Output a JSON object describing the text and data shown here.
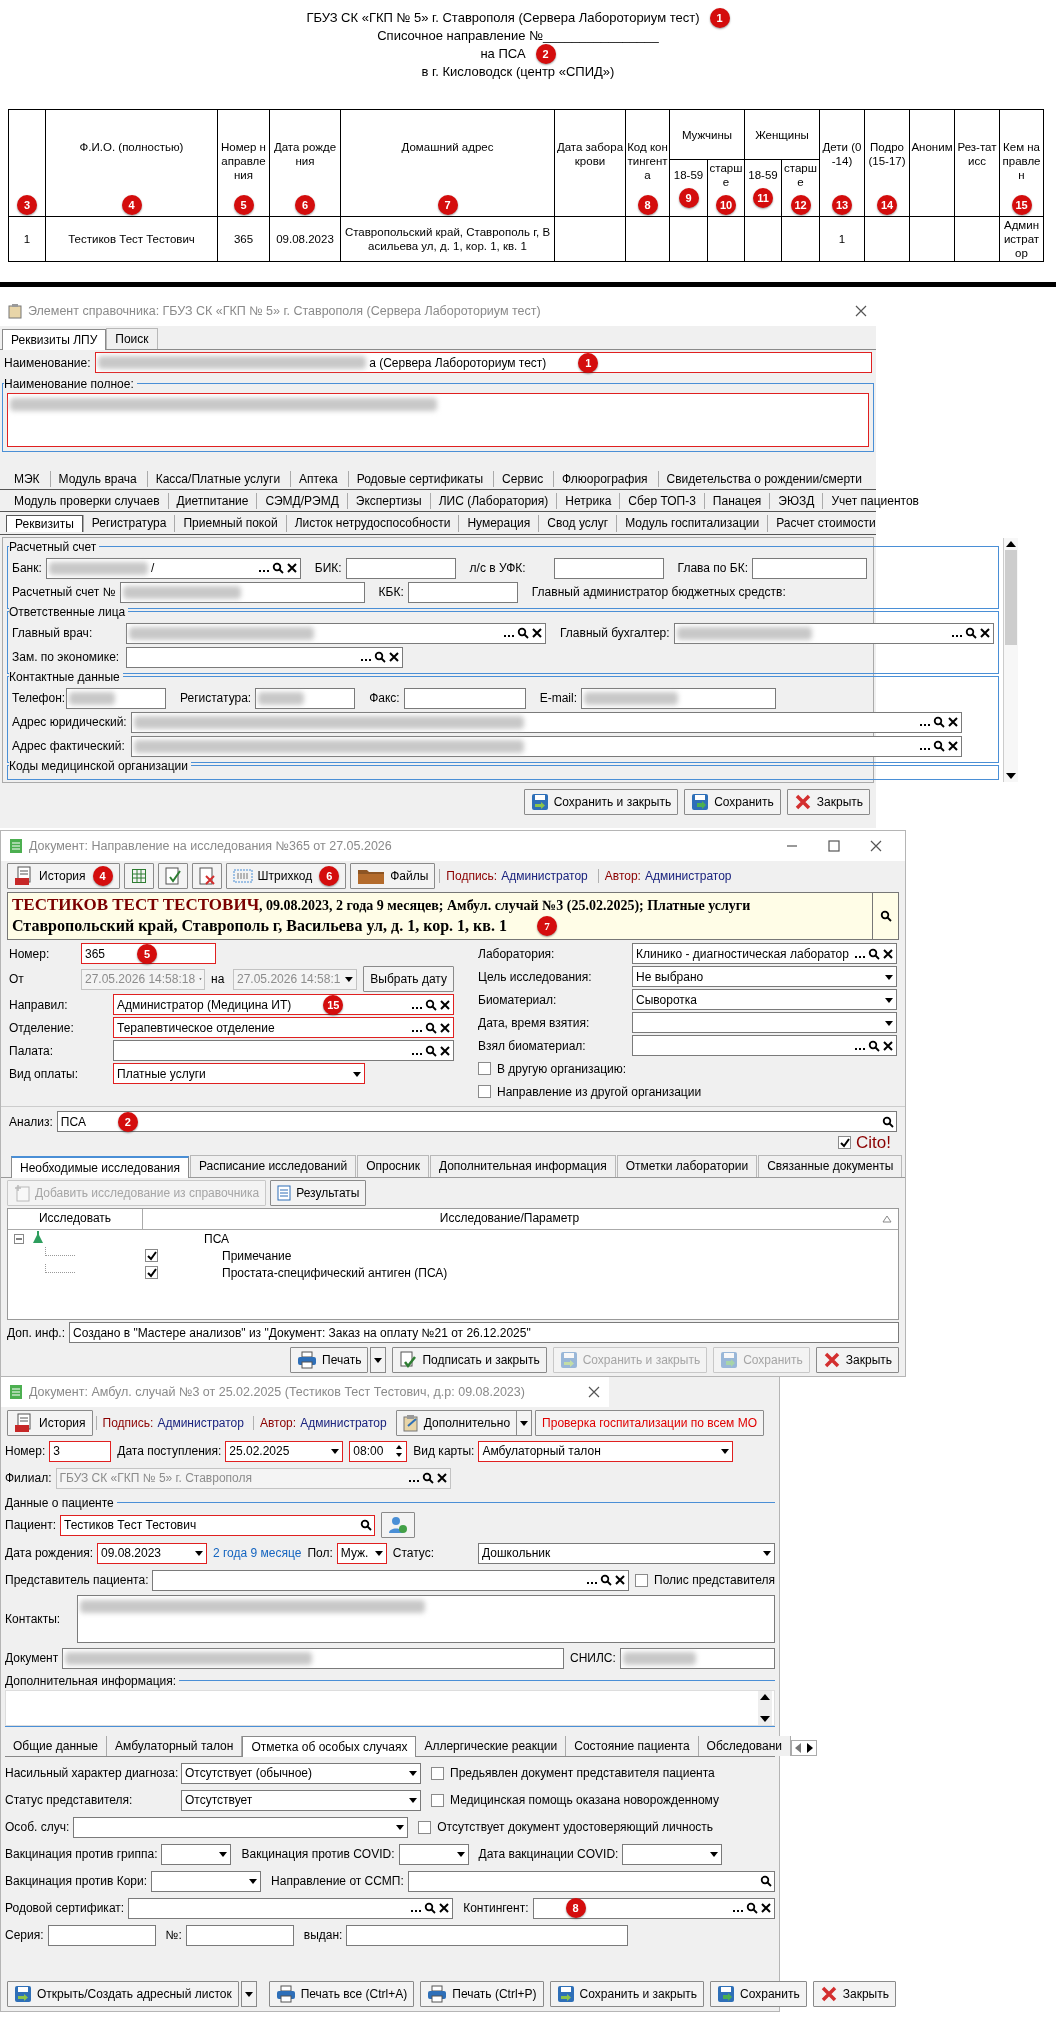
{
  "report": {
    "lines": [
      {
        "text": "ГБУЗ СК «ГКП № 5» г. Ставрополя (Сервера Лабороториум тест)",
        "callout": "1"
      },
      {
        "text": "Списочное направление №________________"
      },
      {
        "text": "на ПСА",
        "callout": "2"
      },
      {
        "text": "в г. Кисловодск (центр «СПИД»)"
      }
    ],
    "columns": [
      {
        "in_group": false,
        "callout": "3"
      },
      {
        "label": "Ф.И.О. (полностью)",
        "in_group": false,
        "callout": "4"
      },
      {
        "label": "Номер направления",
        "in_group": false,
        "callout": "5"
      },
      {
        "label": "Дата рождения",
        "in_group": false,
        "callout": "6"
      },
      {
        "label": "Домашний адрес",
        "in_group": false,
        "callout": "7"
      },
      {
        "label": "Дата забора крови",
        "in_group": false
      },
      {
        "label": "Код контингента",
        "in_group": false,
        "callout": "8"
      },
      {
        "group": "Мужчины",
        "label": "18-59",
        "in_group": true,
        "callout": "9"
      },
      {
        "label": "старше",
        "in_group": true,
        "callout": "10"
      },
      {
        "group": "Женщины",
        "label": "18-59",
        "in_group": true,
        "callout": "11"
      },
      {
        "label": "старше",
        "in_group": true,
        "callout": "12"
      },
      {
        "label": "Дети (0-14)",
        "in_group": false,
        "callout": "13"
      },
      {
        "label": "Подро (15-17)",
        "in_group": false,
        "callout": "14"
      },
      {
        "label": "Аноним",
        "in_group": false
      },
      {
        "label": "Рез-тат исс",
        "in_group": false
      },
      {
        "label": "Кем направлен",
        "in_group": false,
        "callout": "15"
      }
    ],
    "rows": [
      {
        "cells": [
          "1",
          "Тестиков Тест Тестович",
          "365",
          "09.08.2023",
          "Ставропольский край, Ставрополь г, Васильева ул, д. 1, кор. 1, кв. 1",
          null,
          null,
          null,
          null,
          null,
          null,
          "1",
          null,
          null,
          null,
          "Администратор"
        ]
      }
    ]
  },
  "reference_window": {
    "title": "Элемент справочника: ГБУЗ СК «ГКП № 5» г. Ставрополя (Сервера Лабороториум тест)",
    "tabs": [
      {
        "label": "Реквизиты ЛПУ",
        "selected": true
      },
      {
        "label": "Поиск",
        "selected": false
      }
    ],
    "name_field": {
      "label": "Наименование:",
      "value": "а (Сервера Лабороториум тест)",
      "kind": "text",
      "required": true,
      "disabled": false,
      "masked": true,
      "callout": "1"
    },
    "full_name": {
      "label": "Наименование полное:",
      "kind": "textarea",
      "required": true,
      "disabled": false,
      "masked": true
    },
    "module_tabs": [
      [
        {
          "label": "МЭК",
          "selected": false
        },
        {
          "label": "Модуль врача",
          "selected": false
        },
        {
          "label": "Касса/Платные услуги",
          "selected": false
        },
        {
          "label": "Аптека",
          "selected": false
        },
        {
          "label": "Родовые сертификаты",
          "selected": false
        },
        {
          "label": "Сервис",
          "selected": false
        },
        {
          "label": "Флюорография",
          "selected": false
        },
        {
          "label": "Свидетельства о рождении/смерти",
          "selected": false
        }
      ],
      [
        {
          "label": "Модуль проверки случаев",
          "selected": false
        },
        {
          "label": "Диетпитание",
          "selected": false
        },
        {
          "label": "СЭМД/РЭМД",
          "selected": false
        },
        {
          "label": "Экспертизы",
          "selected": false
        },
        {
          "label": "ЛИС (Лаборатория)",
          "selected": false
        },
        {
          "label": "Нетрика",
          "selected": false
        },
        {
          "label": "Сбер ТОП-3",
          "selected": false
        },
        {
          "label": "Панацея",
          "selected": false
        },
        {
          "label": "ЭЮЗД",
          "selected": false
        },
        {
          "label": "Учет пациентов",
          "selected": false
        }
      ],
      [
        {
          "label": "Реквизиты",
          "selected": true
        },
        {
          "label": "Регистратура",
          "selected": false
        },
        {
          "label": "Приемный покой",
          "selected": false
        },
        {
          "label": "Листок нетрудоспособности",
          "selected": false
        },
        {
          "label": "Нумерация",
          "selected": false
        },
        {
          "label": "Свод услуг",
          "selected": false
        },
        {
          "label": "Модуль госпитализации",
          "selected": false
        },
        {
          "label": "Расчет стоимости",
          "selected": false
        }
      ]
    ],
    "groups": [
      {
        "title": "Расчетный счет",
        "fields": [
          {
            "label": "Банк:",
            "value": "/",
            "kind": "lookup",
            "required": false,
            "disabled": false,
            "masked": true
          },
          {
            "label": "БИК:",
            "kind": "text",
            "required": false,
            "disabled": false,
            "masked": false
          },
          {
            "label": "л/с в УФК:",
            "kind": "text",
            "required": false,
            "disabled": false,
            "masked": false
          },
          {
            "label": "Глава по БК:",
            "kind": "text",
            "required": false,
            "disabled": false,
            "masked": false
          },
          {
            "label": "Расчетный счет №",
            "kind": "text",
            "required": false,
            "disabled": false,
            "masked": true
          },
          {
            "label": "КБК:",
            "kind": "text",
            "required": false,
            "disabled": false,
            "masked": false
          },
          {
            "label": "Главный администратор бюджетных средств:",
            "kind": "label"
          }
        ]
      },
      {
        "title": "Ответственные лица",
        "fields": [
          {
            "label": "Главный врач:",
            "kind": "lookup",
            "required": false,
            "disabled": false,
            "masked": true
          },
          {
            "label": "Главный бухгалтер:",
            "kind": "lookup",
            "required": false,
            "disabled": false,
            "masked": true
          },
          {
            "label": "Зам. по экономике:",
            "kind": "lookup",
            "required": false,
            "disabled": false,
            "masked": false
          }
        ]
      },
      {
        "title": "Контактные данные",
        "fields": [
          {
            "label": "Телефон:",
            "kind": "text",
            "required": false,
            "disabled": false,
            "masked": true
          },
          {
            "label": "Регистатура:",
            "kind": "text",
            "required": false,
            "disabled": false,
            "masked": true
          },
          {
            "label": "Факс:",
            "kind": "text",
            "required": false,
            "disabled": false,
            "masked": false
          },
          {
            "label": "E-mail:",
            "kind": "text",
            "required": false,
            "disabled": false,
            "masked": true
          },
          {
            "label": "Адрес юридический:",
            "kind": "lookup",
            "required": false,
            "disabled": false,
            "masked": true
          },
          {
            "label": "Адрес фактический:",
            "kind": "lookup",
            "required": false,
            "disabled": false,
            "masked": true
          }
        ]
      },
      {
        "title": "Коды медицинской организации"
      }
    ],
    "buttons": [
      {
        "kind": "save_close",
        "label": "Сохранить и закрыть",
        "disabled": false
      },
      {
        "kind": "save",
        "label": "Сохранить",
        "disabled": false
      },
      {
        "kind": "close",
        "label": "Закрыть",
        "disabled": false
      }
    ]
  },
  "referral_window": {
    "title": "Документ: Направление на исследования №365 от 27.05.2026",
    "toolbar": [
      {
        "kind": "history",
        "label": "История",
        "disabled": false,
        "callout": "4"
      },
      {
        "kind": "grid",
        "disabled": false
      },
      {
        "kind": "check_doc",
        "disabled": false
      },
      {
        "kind": "delete_doc",
        "disabled": false
      },
      {
        "kind": "barcode",
        "label": "Штрихкод",
        "disabled": false,
        "callout": "6"
      },
      {
        "kind": "files",
        "label": "Файлы",
        "disabled": false
      }
    ],
    "signature": {
      "label": "Подпись:",
      "value": "Администратор"
    },
    "author": {
      "label": "Автор:",
      "value": "Администратор"
    },
    "summary": {
      "name": "ТЕСТИКОВ ТЕСТ ТЕСТОВИЧ",
      "details": ", 09.08.2023, 2 года 9 месяцев; Амбул. случай №3 (25.02.2025); Платные услуги",
      "address": "Ставропольский край, Ставрополь г, Васильева ул, д. 1, кор. 1, кв. 1",
      "callout": "7"
    },
    "left_fields": [
      {
        "label": "Номер:",
        "value": "365",
        "kind": "text",
        "required": true,
        "disabled": false,
        "masked": false,
        "callout": "5"
      },
      {
        "label": "От",
        "value": "27.05.2026 14:58:18",
        "kind": "combo",
        "required": false,
        "disabled": true,
        "masked": false
      },
      {
        "label": "на",
        "value": "27.05.2026 14:58:1",
        "kind": "combo",
        "required": false,
        "disabled": true,
        "masked": false
      },
      {
        "kind": "date_button",
        "label": "Выбрать дату",
        "disabled": false
      },
      {
        "label": "Направил:",
        "value": "Администратор (Медицина ИТ)",
        "kind": "lookup",
        "required": true,
        "disabled": false,
        "masked": false,
        "callout": "15"
      },
      {
        "label": "Отделение:",
        "value": "Терапевтическое отделение",
        "kind": "lookup",
        "required": true,
        "disabled": false,
        "masked": false
      },
      {
        "label": "Палата:",
        "kind": "lookup",
        "required": false,
        "disabled": false,
        "masked": false
      },
      {
        "label": "Вид оплаты:",
        "value": "Платные услуги",
        "kind": "combo",
        "required": true,
        "disabled": false,
        "masked": false
      }
    ],
    "right_fields": [
      {
        "label": "Лаборатория:",
        "value": "Клинико - диагностическая лаборатор",
        "kind": "lookup",
        "required": false,
        "disabled": false,
        "masked": false
      },
      {
        "label": "Цель исследования:",
        "value": "Не выбрано",
        "kind": "combo",
        "required": false,
        "disabled": false,
        "masked": false
      },
      {
        "label": "Биоматериал:",
        "value": "Сыворотка",
        "kind": "combo",
        "required": false,
        "disabled": false,
        "masked": false
      },
      {
        "label": "Дата, время взятия:",
        "kind": "combo",
        "required": false,
        "disabled": false,
        "masked": false
      },
      {
        "label": "Взял биоматериал:",
        "kind": "lookup",
        "required": false,
        "disabled": false,
        "masked": false
      },
      {
        "label": "В другую организацию:",
        "kind": "checkbox",
        "checked": false
      },
      {
        "label": "Направление из другой организации",
        "kind": "checkbox",
        "checked": false
      }
    ],
    "analysis": {
      "label": "Анализ:",
      "value": "ПСА",
      "kind": "search",
      "required": false,
      "disabled": false,
      "masked": false,
      "callout": "2"
    },
    "cito": {
      "label": "Cito!",
      "checked": true
    },
    "tabs": [
      {
        "label": "Необходимые исследования",
        "selected": true
      },
      {
        "label": "Расписание исследований",
        "selected": false
      },
      {
        "label": "Опросник",
        "selected": false
      },
      {
        "label": "Дополнительная информация",
        "selected": false
      },
      {
        "label": "Отметки лаборатории",
        "selected": false
      },
      {
        "label": "Связанные документы",
        "selected": false
      }
    ],
    "tab_toolbar": [
      {
        "kind": "add",
        "label": "Добавить исследование из справочника",
        "disabled": true
      },
      {
        "kind": "results",
        "label": "Результаты",
        "disabled": false
      }
    ],
    "grid_columns": [
      "Исследовать",
      "Исследование/Параметр"
    ],
    "tree": [
      {
        "label": "ПСА",
        "expanded": true,
        "children": [
          {
            "label": "Примечание",
            "checked": true
          },
          {
            "label": "Простата-специфический антиген (ПСА)",
            "checked": true
          }
        ]
      }
    ],
    "note": {
      "label": "Доп. инф.:",
      "value": "Создано в \"Мастере анализов\" из \"Документ: Заказ на оплату №21 от 26.12.2025\"",
      "kind": "text",
      "required": false,
      "disabled": false,
      "masked": false
    },
    "buttons": [
      {
        "kind": "print",
        "label": "Печать",
        "disabled": false,
        "menu": true
      },
      {
        "kind": "sign",
        "label": "Подписать и закрыть",
        "disabled": false
      },
      {
        "kind": "save_close",
        "label": "Сохранить и закрыть",
        "disabled": true
      },
      {
        "kind": "save",
        "label": "Сохранить",
        "disabled": true
      },
      {
        "kind": "close",
        "label": "Закрыть",
        "disabled": false
      }
    ]
  },
  "case_window": {
    "title": "Документ: Амбул. случай №3 от 25.02.2025 (Тестиков Тест Тестович, д.р: 09.08.2023)",
    "toolbar": [
      {
        "kind": "history",
        "label": "История",
        "disabled": false
      }
    ],
    "signature": {
      "label": "Подпись:",
      "value": "Администратор"
    },
    "author": {
      "label": "Автор:",
      "value": "Администратор"
    },
    "toolbar_right": [
      {
        "kind": "clipboard",
        "label": "Дополнительно",
        "disabled": false,
        "menu": true
      },
      {
        "kind": "warning",
        "label": "Проверка госпитализации по всем МО",
        "disabled": false
      }
    ],
    "top_fields": [
      {
        "label": "Номер:",
        "value": "3",
        "kind": "text",
        "required": true,
        "disabled": false,
        "masked": false
      },
      {
        "label": "Дата поступления:",
        "value": "25.02.2025",
        "kind": "combo",
        "required": true,
        "disabled": false,
        "masked": false
      },
      {
        "value": "08:00",
        "kind": "spin",
        "required": true,
        "disabled": false,
        "masked": false
      },
      {
        "label": "Вид карты:",
        "value": "Амбулаторный талон",
        "kind": "combo",
        "required": true,
        "disabled": false,
        "masked": false
      },
      {
        "label": "Филиал:",
        "value": "ГБУЗ СК «ГКП № 5» г. Ставрополя",
        "kind": "lookup",
        "required": false,
        "disabled": true,
        "masked": false
      }
    ],
    "patient_group": {
      "title": "Данные о пациенте",
      "fields": [
        {
          "label": "Пациент:",
          "value": "Тестиков Тест Тестович",
          "kind": "search",
          "required": true,
          "disabled": false,
          "masked": false
        },
        {
          "kind": "patient_button",
          "disabled": false
        },
        {
          "label": "Дата рождения:",
          "value": "09.08.2023",
          "kind": "combo",
          "required": true,
          "disabled": false,
          "masked": false
        },
        {
          "kind": "link",
          "label": "2 года 9 месяце"
        },
        {
          "label": "Пол:",
          "value": "Муж.",
          "kind": "combo",
          "required": true,
          "disabled": false,
          "masked": false
        },
        {
          "label": "Статус:",
          "value": "Дошкольник",
          "kind": "combo",
          "required": false,
          "disabled": false,
          "masked": false
        },
        {
          "label": "Представитель пациента:",
          "kind": "lookup",
          "required": false,
          "disabled": false,
          "masked": false
        },
        {
          "label": "Полис представителя",
          "kind": "checkbox",
          "checked": false
        },
        {
          "label": "Контакты:",
          "kind": "textarea",
          "required": false,
          "disabled": false,
          "masked": true
        },
        {
          "label": "Документ",
          "kind": "text",
          "required": false,
          "disabled": false,
          "masked": true
        },
        {
          "label": "СНИЛС:",
          "kind": "text",
          "required": false,
          "disabled": false,
          "masked": true
        }
      ]
    },
    "extra_group": {
      "title": "Дополнительная информация:"
    },
    "tabs": [
      {
        "label": "Общие данные",
        "selected": false
      },
      {
        "label": "Амбулаторный талон",
        "selected": false
      },
      {
        "label": "Отметка об особых случаях",
        "selected": true
      },
      {
        "label": "Аллергические реакции",
        "selected": false
      },
      {
        "label": "Состояние пациента",
        "selected": false
      },
      {
        "label": "Обследовани",
        "selected": false
      }
    ],
    "tab_fields": [
      {
        "label": "Насильный характер диагноза:",
        "value": "Отсутствует (обычное)",
        "kind": "combo",
        "required": false,
        "disabled": false,
        "masked": false
      },
      {
        "label": "Предьявлен документ представителя пациента",
        "kind": "checkbox",
        "checked": false
      },
      {
        "label": "Статус представителя:",
        "value": "Отсутствует",
        "kind": "combo",
        "required": false,
        "disabled": false,
        "masked": false
      },
      {
        "label": "Медицинская помощь оказана новорожденному",
        "kind": "checkbox",
        "checked": false
      },
      {
        "label": "Особ. случ:",
        "kind": "combo",
        "required": false,
        "disabled": false,
        "masked": false
      },
      {
        "label": "Отсутствует документ удостоверяющий личность",
        "kind": "checkbox",
        "checked": false
      },
      {
        "label": "Вакцинация против гриппа:",
        "kind": "combo",
        "required": false,
        "disabled": false,
        "masked": false
      },
      {
        "label": "Вакцинация против COVID:",
        "kind": "combo",
        "required": false,
        "disabled": false,
        "masked": false
      },
      {
        "label": "Дата вакцинации COVID:",
        "kind": "combo",
        "required": false,
        "disabled": false,
        "masked": false
      },
      {
        "label": "Вакцинация против Кори:",
        "kind": "combo",
        "required": false,
        "disabled": false,
        "masked": false
      },
      {
        "label": "Направление от ССМП:",
        "kind": "search",
        "required": false,
        "disabled": false,
        "masked": false
      },
      {
        "label": "Родовой сертификат:",
        "kind": "lookup",
        "required": false,
        "disabled": false,
        "masked": false
      },
      {
        "label": "Контингент:",
        "kind": "lookup",
        "required": false,
        "disabled": false,
        "masked": false,
        "callout": "8"
      },
      {
        "label": "Серия:",
        "kind": "text",
        "required": false,
        "disabled": false,
        "masked": false
      },
      {
        "label": "№:",
        "kind": "text",
        "required": false,
        "disabled": false,
        "masked": false
      },
      {
        "label": "выдан:",
        "kind": "text",
        "required": false,
        "disabled": false,
        "masked": false
      }
    ],
    "buttons": [
      {
        "kind": "address",
        "label": "Открыть/Создать адресный листок",
        "disabled": false,
        "menu": true
      },
      {
        "kind": "print",
        "label": "Печать все (Ctrl+A)",
        "disabled": false
      },
      {
        "kind": "print",
        "label": "Печать (Ctrl+P)",
        "disabled": false
      },
      {
        "kind": "save_close",
        "label": "Сохранить и закрыть",
        "disabled": false
      },
      {
        "kind": "save",
        "label": "Сохранить",
        "disabled": false
      },
      {
        "kind": "close",
        "label": "Закрыть",
        "disabled": false
      }
    ]
  }
}
